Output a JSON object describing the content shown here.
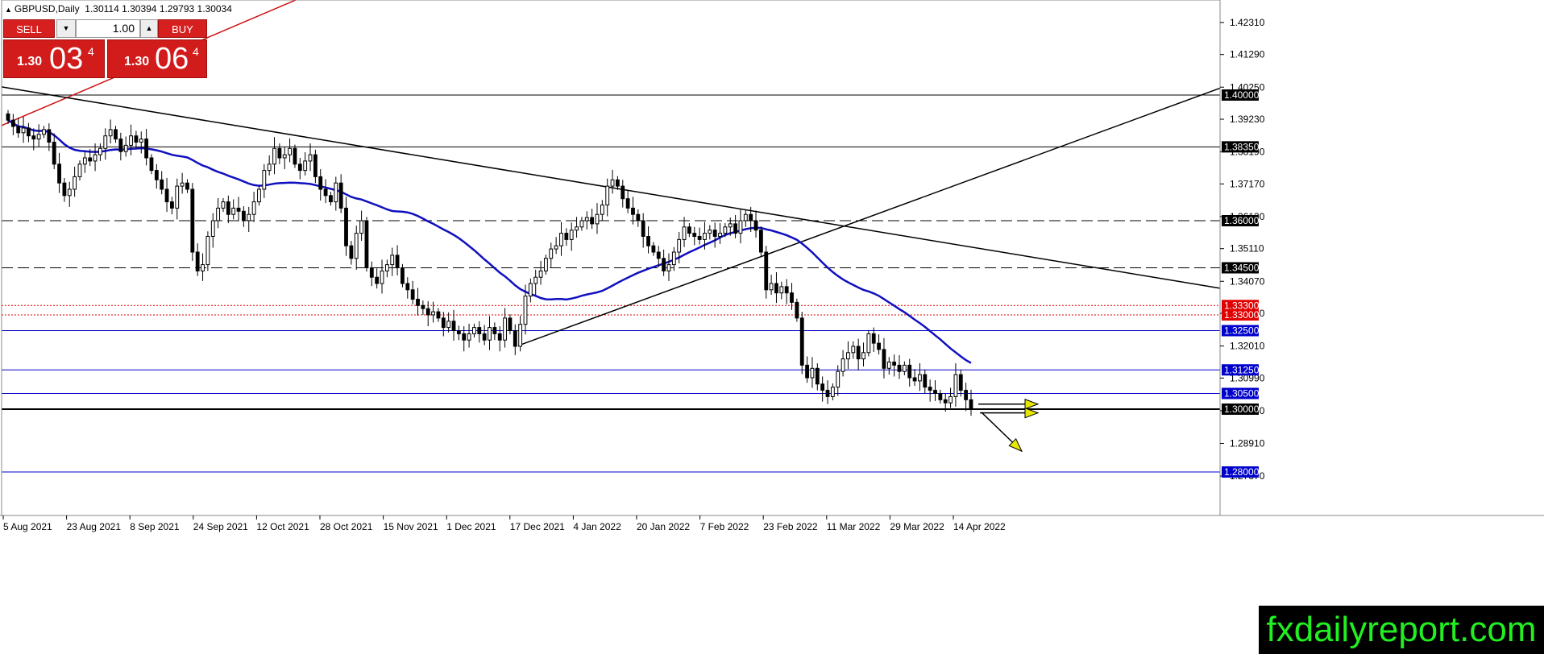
{
  "header": {
    "symbol": "GBPUSD,Daily",
    "ohlc": "1.30114 1.30394 1.29793 1.30034"
  },
  "trade_panel": {
    "sell_label": "SELL",
    "buy_label": "BUY",
    "lot": "1.00",
    "sell_small": "1.30",
    "sell_big": "03",
    "sell_sup": "4",
    "buy_small": "1.30",
    "buy_big": "06",
    "buy_sup": "4",
    "down_icon": "triangle-down-icon",
    "up_icon": "triangle-up-icon"
  },
  "brand": "fxdailyreport.com",
  "chart_data": {
    "type": "candlestick",
    "instrument": "GBPUSD",
    "timeframe": "Daily",
    "ylim": [
      1.276,
      1.43
    ],
    "price_ticks": [
      "1.42310",
      "1.41290",
      "1.40250",
      "1.39230",
      "1.38190",
      "1.37170",
      "1.36130",
      "1.35110",
      "1.34070",
      "1.33050",
      "1.32010",
      "1.30990",
      "1.29950",
      "1.28910",
      "1.27870"
    ],
    "date_ticks": [
      "5 Aug 2021",
      "23 Aug 2021",
      "8 Sep 2021",
      "24 Sep 2021",
      "12 Oct 2021",
      "28 Oct 2021",
      "15 Nov 2021",
      "1 Dec 2021",
      "17 Dec 2021",
      "4 Jan 2022",
      "20 Jan 2022",
      "7 Feb 2022",
      "23 Feb 2022",
      "11 Mar 2022",
      "29 Mar 2022",
      "14 Apr 2022"
    ],
    "closes": [
      1.392,
      1.39,
      1.388,
      1.3895,
      1.387,
      1.386,
      1.3875,
      1.389,
      1.385,
      1.378,
      1.372,
      1.368,
      1.37,
      1.374,
      1.378,
      1.38,
      1.379,
      1.381,
      1.383,
      1.387,
      1.389,
      1.386,
      1.382,
      1.384,
      1.387,
      1.385,
      1.386,
      1.38,
      1.376,
      1.373,
      1.37,
      1.366,
      1.364,
      1.371,
      1.372,
      1.37,
      1.35,
      1.344,
      1.346,
      1.355,
      1.36,
      1.364,
      1.366,
      1.362,
      1.364,
      1.363,
      1.36,
      1.362,
      1.366,
      1.37,
      1.376,
      1.378,
      1.383,
      1.38,
      1.381,
      1.383,
      1.378,
      1.376,
      1.379,
      1.381,
      1.374,
      1.37,
      1.368,
      1.366,
      1.372,
      1.364,
      1.352,
      1.348,
      1.356,
      1.36,
      1.345,
      1.342,
      1.34,
      1.344,
      1.346,
      1.349,
      1.345,
      1.34,
      1.338,
      1.335,
      1.333,
      1.332,
      1.33,
      1.331,
      1.329,
      1.326,
      1.328,
      1.325,
      1.324,
      1.322,
      1.324,
      1.326,
      1.324,
      1.322,
      1.326,
      1.324,
      1.322,
      1.329,
      1.325,
      1.32,
      1.327,
      1.336,
      1.34,
      1.342,
      1.344,
      1.348,
      1.351,
      1.352,
      1.356,
      1.354,
      1.357,
      1.358,
      1.36,
      1.361,
      1.359,
      1.362,
      1.365,
      1.371,
      1.373,
      1.371,
      1.367,
      1.364,
      1.362,
      1.36,
      1.355,
      1.352,
      1.35,
      1.348,
      1.344,
      1.346,
      1.35,
      1.354,
      1.358,
      1.356,
      1.355,
      1.354,
      1.356,
      1.357,
      1.355,
      1.356,
      1.358,
      1.359,
      1.356,
      1.36,
      1.362,
      1.36,
      1.357,
      1.35,
      1.338,
      1.34,
      1.337,
      1.339,
      1.337,
      1.334,
      1.329,
      1.314,
      1.31,
      1.313,
      1.308,
      1.306,
      1.304,
      1.307,
      1.312,
      1.316,
      1.318,
      1.32,
      1.316,
      1.318,
      1.324,
      1.321,
      1.319,
      1.313,
      1.315,
      1.314,
      1.312,
      1.314,
      1.31,
      1.309,
      1.311,
      1.307,
      1.306,
      1.305,
      1.303,
      1.302,
      1.304,
      1.311,
      1.306,
      1.303,
      1.3003
    ],
    "moving_average": {
      "color": "#1010c0"
    },
    "horizontal_levels": [
      {
        "price": "1.40000",
        "color": "#000000",
        "style": "solid",
        "label_bg": "#000000"
      },
      {
        "price": "1.38350",
        "color": "#000000",
        "style": "solid",
        "label_bg": "#000000"
      },
      {
        "price": "1.36000",
        "color": "#000000",
        "style": "dashed",
        "label_bg": "#000000"
      },
      {
        "price": "1.34500",
        "color": "#000000",
        "style": "dashed",
        "label_bg": "#000000"
      },
      {
        "price": "1.33300",
        "color": "#e00000",
        "style": "dotted",
        "label_bg": "#e00000"
      },
      {
        "price": "1.33000",
        "color": "#e00000",
        "style": "dotted",
        "label_bg": "#e00000"
      },
      {
        "price": "1.32500",
        "color": "#0000cc",
        "style": "solid",
        "label_bg": "#0000cc"
      },
      {
        "price": "1.31250",
        "color": "#0000cc",
        "style": "solid",
        "label_bg": "#0000cc"
      },
      {
        "price": "1.30500",
        "color": "#0000cc",
        "style": "solid",
        "label_bg": "#0000cc"
      },
      {
        "price": "1.30000",
        "color": "#000000",
        "style": "solid",
        "label_bg": "#000000"
      },
      {
        "price": "1.28000",
        "color": "#0000cc",
        "style": "solid",
        "label_bg": "#0000cc"
      }
    ],
    "trendlines": [
      {
        "name": "red-channel",
        "color": "#d01010"
      },
      {
        "name": "descending-resistance",
        "color": "#000000"
      },
      {
        "name": "ascending-support",
        "color": "#000000"
      }
    ],
    "arrow_color": "#e6e600",
    "grid": false
  }
}
